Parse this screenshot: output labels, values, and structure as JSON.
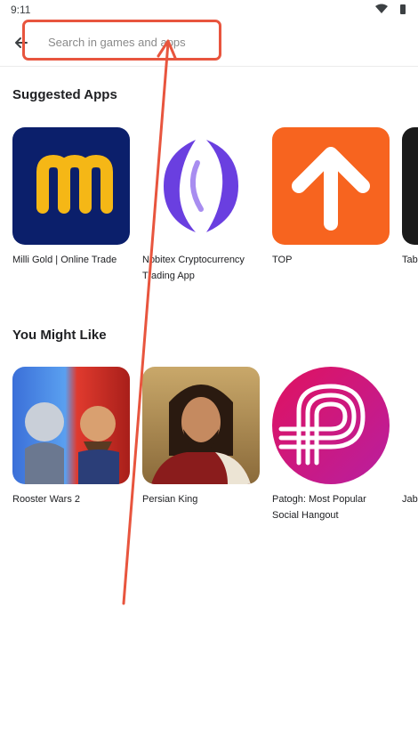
{
  "status": {
    "time": "9:11"
  },
  "search": {
    "placeholder": "Search in games and apps",
    "value": ""
  },
  "sections": [
    {
      "title": "Suggested Apps",
      "apps": [
        {
          "name": "Milli Gold | Online Trade",
          "icon": "milli-gold-logo"
        },
        {
          "name": "Nobitex Cryptocurrency Trading App",
          "icon": "nobitex-logo"
        },
        {
          "name": "TOP",
          "icon": "top-arrow-logo"
        },
        {
          "name": "Tab",
          "icon": "tab-app-logo"
        }
      ]
    },
    {
      "title": "You Might Like",
      "apps": [
        {
          "name": "Rooster Wars 2",
          "icon": "rooster-wars-art"
        },
        {
          "name": "Persian King",
          "icon": "persian-king-art"
        },
        {
          "name": "Patogh: Most Popular Social Hangout",
          "icon": "patogh-logo"
        },
        {
          "name": "Jab Plat",
          "icon": "jab-plat-logo"
        }
      ]
    }
  ],
  "colors": {
    "highlight": "#e8553e",
    "milli_bg": "#0b1f6b",
    "milli_letter": "#f5b716",
    "nobitex_purple": "#6a3fe0",
    "top_orange": "#f7641f",
    "patogh_magenta": "#d6136b"
  }
}
